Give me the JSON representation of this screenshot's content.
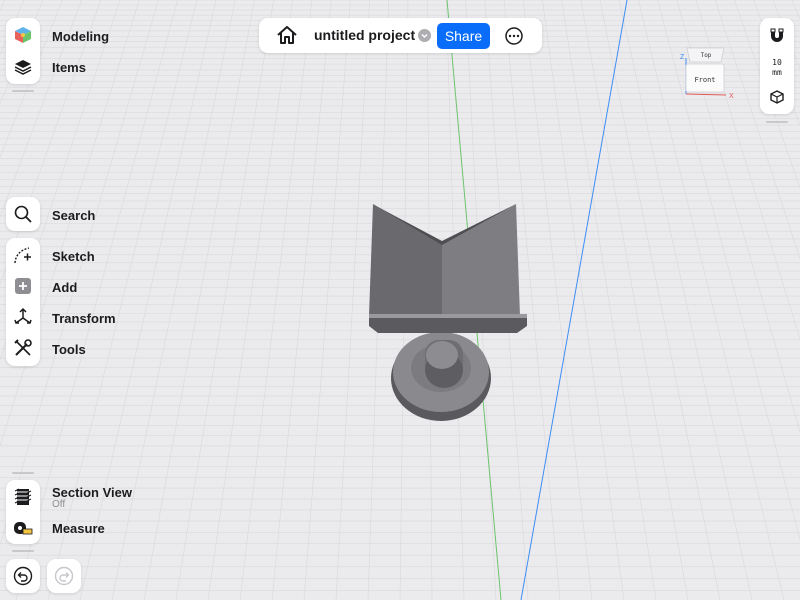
{
  "app": {
    "project_title": "untitled project",
    "share_label": "Share"
  },
  "left_top": {
    "items": [
      {
        "label": "Modeling",
        "icon": "modeling-cube-icon"
      },
      {
        "label": "Items",
        "icon": "layers-icon"
      }
    ]
  },
  "tools": {
    "search_label": "Search",
    "sketch_label": "Sketch",
    "add_label": "Add",
    "transform_label": "Transform",
    "tools_label": "Tools"
  },
  "bottom_tools": {
    "section_view_label": "Section View",
    "section_view_state": "Off",
    "measure_label": "Measure"
  },
  "right_panel": {
    "units_value": "10",
    "units_unit": "mm"
  },
  "view_cube": {
    "top_label": "Top",
    "front_label": "Front",
    "axis_z": "Z",
    "axis_x": "X"
  },
  "colors": {
    "background": "#ebebed",
    "grid": "#d9d9dd",
    "axis_green": "#6cc46c",
    "axis_blue": "#3d8df5",
    "share_button": "#0a6dfa",
    "model_gray": "#7a7a7e"
  }
}
